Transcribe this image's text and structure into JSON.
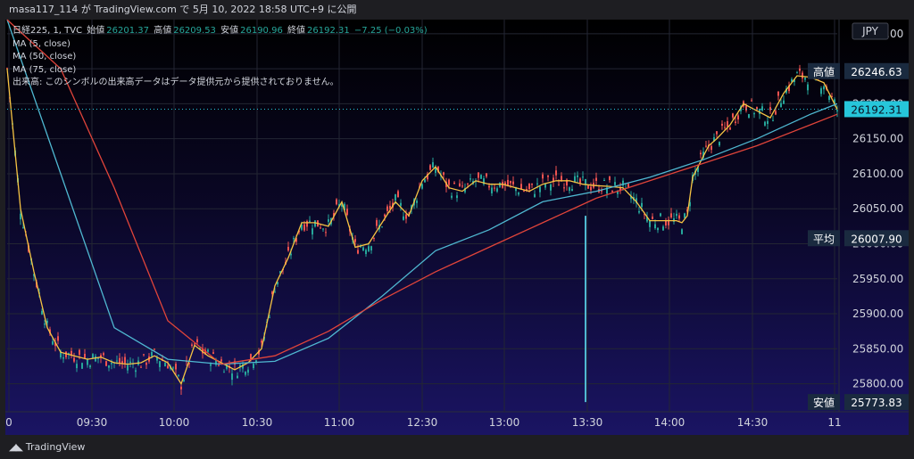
{
  "header": {
    "share_line": "masa117_114 が TradingView.com で 5月 10, 2022 18:58 UTC+9 に公開"
  },
  "legend": {
    "symbol": "日経225, 1, TVC",
    "open_label": "始値",
    "open": "26201.37",
    "high_label": "高値",
    "high": "26209.53",
    "low_label": "安値",
    "low": "26190.96",
    "close_label": "終値",
    "close": "26192.31",
    "change": "−7.25 (−0.03%)",
    "ma5": "MA (5, close)",
    "ma50": "MA (50, close)",
    "ma75": "MA (75, close)",
    "volume_note": "出来高: このシンボルの出来高データはデータ提供元から提供されておりません。"
  },
  "currency": "JPY",
  "price_tags": {
    "high_label": "高値",
    "high": "26246.63",
    "last": "26192.31",
    "avg_label": "平均",
    "avg": "26007.90",
    "low_label": "安値",
    "low": "25773.83"
  },
  "brand": {
    "name": "TradingView"
  },
  "colors": {
    "up": "#26a69a",
    "down": "#ef5350",
    "ma5": "#f6c343",
    "ma50": "#4fb8d1",
    "ma75": "#e0443a",
    "last_tag": "#26c6da",
    "tag_bg": "#1a2a3f"
  },
  "chart_data": {
    "type": "line",
    "title": "日経225, 1, TVC",
    "x_ticks": [
      "0",
      "09:30",
      "10:00",
      "10:30",
      "11:00",
      "12:30",
      "13:00",
      "13:30",
      "14:00",
      "14:30",
      "11"
    ],
    "y_ticks": [
      25800,
      25850,
      25900,
      25950,
      26000,
      26050,
      26100,
      26150,
      26200,
      26250,
      26300
    ],
    "ylim": [
      25760,
      26310
    ],
    "grid": true,
    "series": [
      {
        "name": "MA (5, close)",
        "x": [
          0,
          5,
          10,
          15,
          20,
          25,
          30,
          35,
          40,
          45,
          50,
          55,
          60,
          65,
          70,
          75,
          80,
          85,
          90,
          95,
          100,
          105,
          110,
          115,
          120,
          125,
          130,
          135,
          140,
          145,
          150,
          155,
          160,
          165,
          170,
          175,
          180,
          185,
          190,
          195,
          200,
          205,
          210,
          215,
          220,
          225,
          230,
          235,
          240,
          245,
          250,
          252,
          254,
          256,
          258,
          262,
          265,
          270,
          275,
          280,
          285,
          290,
          295,
          300,
          305,
          310
        ],
        "y": [
          26250,
          26050,
          25960,
          25880,
          25845,
          25840,
          25835,
          25838,
          25830,
          25828,
          25830,
          25840,
          25830,
          25800,
          25855,
          25840,
          25830,
          25820,
          25830,
          25850,
          25940,
          25980,
          26030,
          26030,
          26025,
          26060,
          25995,
          26000,
          26030,
          26060,
          26040,
          26090,
          26110,
          26080,
          26075,
          26090,
          26085,
          26085,
          26080,
          26075,
          26085,
          26090,
          26090,
          26085,
          26083,
          26082,
          26080,
          26060,
          26033,
          26033,
          26033,
          26030,
          26040,
          26095,
          26110,
          26140,
          26150,
          26170,
          26200,
          26190,
          26180,
          26215,
          26240,
          26238,
          26230,
          26192
        ]
      },
      {
        "name": "MA (50, close)",
        "x": [
          0,
          20,
          40,
          60,
          80,
          100,
          120,
          140,
          160,
          180,
          200,
          220,
          240,
          260,
          280,
          300,
          310
        ],
        "y": [
          26320,
          26100,
          25880,
          25835,
          25828,
          25832,
          25865,
          25925,
          25990,
          26020,
          26060,
          26075,
          26095,
          26120,
          26150,
          26185,
          26200
        ]
      },
      {
        "name": "MA (75, close)",
        "x": [
          0,
          20,
          40,
          60,
          80,
          100,
          120,
          140,
          160,
          180,
          200,
          220,
          240,
          260,
          280,
          300,
          310
        ],
        "y": [
          26320,
          26250,
          26080,
          25890,
          25828,
          25840,
          25875,
          25920,
          25960,
          25995,
          26030,
          26065,
          26090,
          26115,
          26140,
          26170,
          26185
        ]
      }
    ],
    "price_levels": {
      "high": 26246.63,
      "last": 26192.31,
      "average": 26007.9,
      "low": 25773.83
    }
  }
}
